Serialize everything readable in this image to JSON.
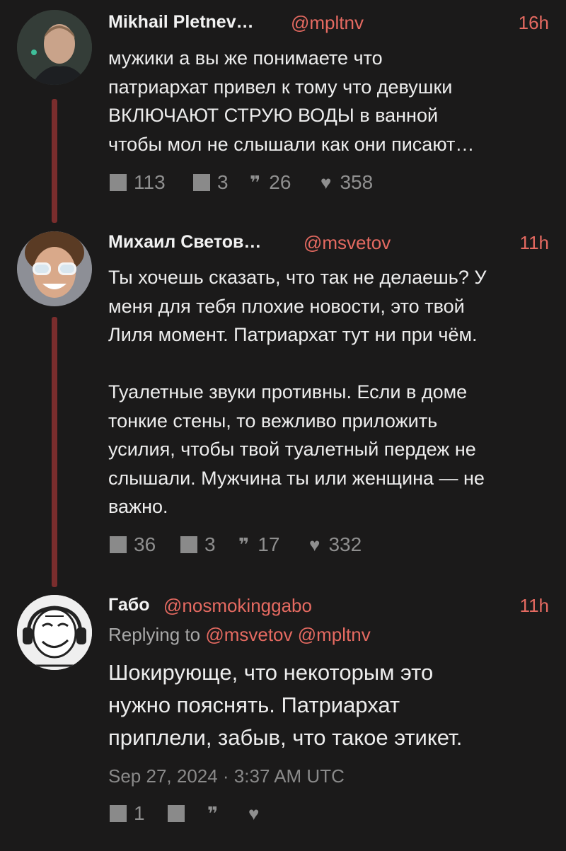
{
  "tweets": [
    {
      "name": "Mikhail Pletnev…",
      "handle": "@mpltnv",
      "time": "16h",
      "text": "мужики а вы же понимаете что\nпатриархат привел к тому что девушки\nВКЛЮЧАЮТ СТРУЮ ВОДЫ в ванной\nчтобы мол не слышали как они писают…",
      "replies": "113",
      "retweets": "3",
      "quotes": "26",
      "likes": "358"
    },
    {
      "name": "Михаил Светов…",
      "handle": "@msvetov",
      "time": "11h",
      "text": "Ты хочешь сказать, что так не делаешь? У\nменя для тебя плохие новости, это твой\nЛиля момент. Патриархат тут ни при чём.\n\nТуалетные звуки противны. Если в доме\nтонкие стены, то вежливо приложить\nусилия, чтобы твой туалетный пердеж не\nслышали. Мужчина ты или женщина — не\nважно.",
      "replies": "36",
      "retweets": "3",
      "quotes": "17",
      "likes": "332"
    },
    {
      "name": "Габо",
      "handle": "@nosmokinggabo",
      "time": "11h",
      "replying_prefix": "Replying to",
      "replying_handles": "@msvetov @mpltnv",
      "text": "Шокирующе, что некоторым это\nнужно пояснять. Патриархат\nприплели, забыв, что такое этикет.",
      "date": "Sep 27, 2024 · 3:37 AM UTC",
      "replies": "1",
      "retweets": "",
      "quotes": "",
      "likes": ""
    }
  ],
  "icons": {
    "reply": "comment-icon",
    "retweet": "retweet-icon",
    "quote": "quote-icon",
    "like": "heart-icon"
  },
  "colors": {
    "accent": "#e56a61",
    "thread_line": "#7a2d2d",
    "background": "#1b1a1a"
  }
}
